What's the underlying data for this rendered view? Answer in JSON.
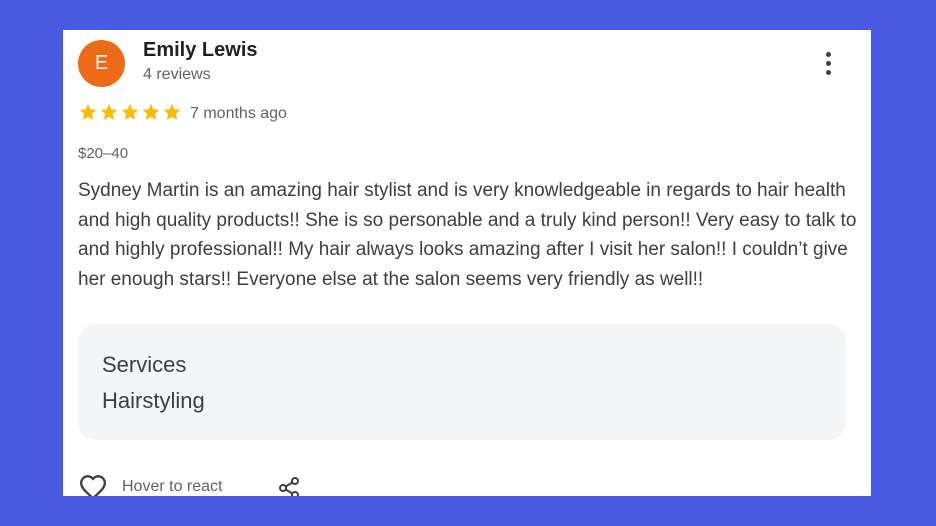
{
  "review": {
    "avatar_letter": "E",
    "avatar_color": "#ec6a18",
    "author_name": "Emily Lewis",
    "author_meta": "4 reviews",
    "rating": 5,
    "rating_max": 5,
    "star_color": "#fbbc04",
    "time_ago": "7 months ago",
    "price_range": "$20–40",
    "text": "Sydney Martin is an amazing hair stylist and is very knowledgeable in regards to hair health and high quality products!! She is so personable and a truly kind person!! Very easy to talk to and highly professional!! My hair always looks amazing after I visit her salon!! I couldn’t give her enough stars!! Everyone else at the salon seems very friendly as well!!",
    "services_label": "Services",
    "services_value": "Hairstyling",
    "react_label": "Hover to react"
  },
  "icons": {
    "more": "more-vert-icon",
    "star": "star-icon",
    "heart": "heart-outline-icon",
    "share": "share-icon"
  },
  "colors": {
    "background": "#4a5ae0",
    "card": "#ffffff",
    "services_box": "#f4f5f7"
  }
}
